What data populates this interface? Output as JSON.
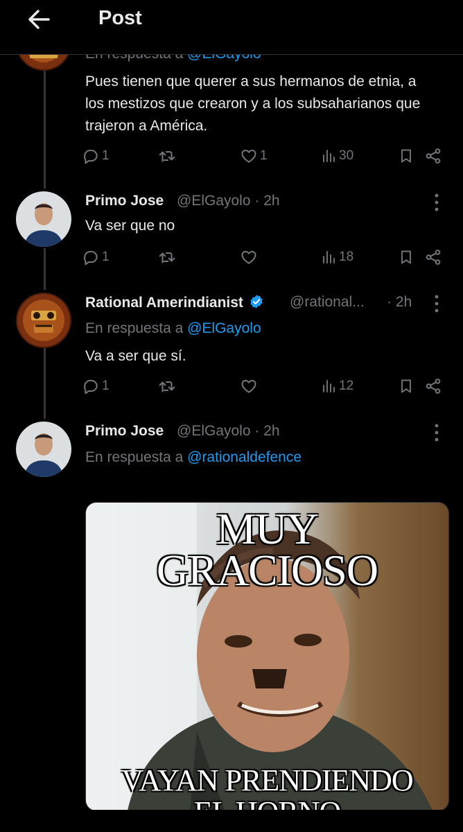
{
  "header": {
    "title": "Post"
  },
  "tweets": [
    {
      "reply_prefix": "En respuesta a",
      "reply_mention": "@ElGayolo",
      "text": "Pues tienen que querer a sus hermanos de etnia, a los mestizos que crearon y a los subsaharianos que trajeron a América.",
      "stats": {
        "replies": "1",
        "reposts": "",
        "likes": "1",
        "views": "30"
      }
    },
    {
      "name": "Primo Jose",
      "handle": "@ElGayolo",
      "time": "· 2h",
      "text": "Va ser que no",
      "stats": {
        "replies": "1",
        "reposts": "",
        "likes": "",
        "views": "18"
      }
    },
    {
      "name": "Rational Amerindianist",
      "verified": true,
      "handle": "@rational...",
      "time": "· 2h",
      "reply_prefix": "En respuesta a",
      "reply_mention": "@ElGayolo",
      "text": "Va a ser que sí.",
      "stats": {
        "replies": "1",
        "reposts": "",
        "likes": "",
        "views": "12"
      }
    },
    {
      "name": "Primo Jose",
      "handle": "@ElGayolo",
      "time": "· 2h",
      "reply_prefix": "En respuesta a",
      "reply_mention": "@rationaldefence",
      "media": {
        "caption_top_1": "MUY",
        "caption_top_2": "GRACIOSO",
        "caption_bottom_1": "VAYAN PRENDIENDO",
        "caption_bottom_2": "EL HORNO"
      }
    }
  ],
  "colors": {
    "accent": "#1d9bf0",
    "muted": "#71767b",
    "text": "#e7e9ea",
    "background": "#000000"
  },
  "icons": [
    "back-arrow-icon",
    "reply-icon",
    "repost-icon",
    "like-icon",
    "views-icon",
    "bookmark-icon",
    "share-icon",
    "more-icon",
    "verified-icon"
  ]
}
